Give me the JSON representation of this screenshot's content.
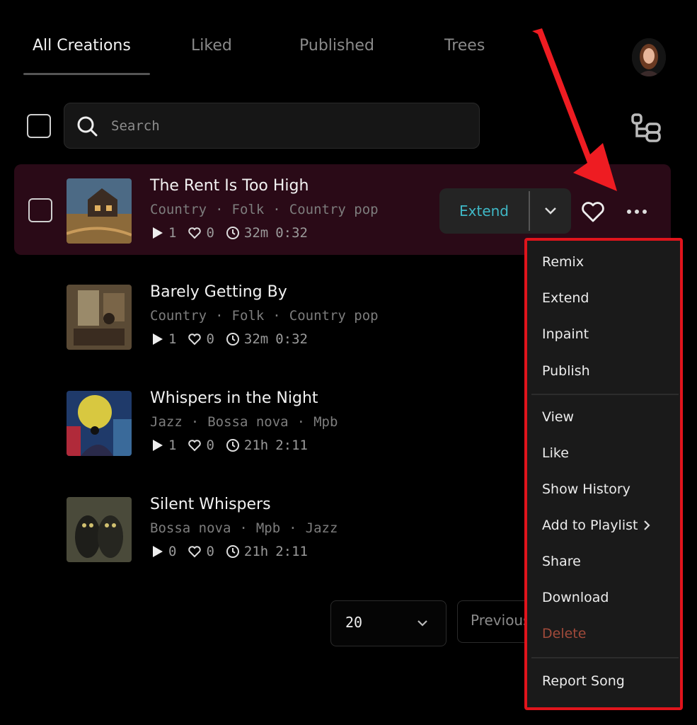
{
  "tabs": [
    {
      "label": "All Creations"
    },
    {
      "label": "Liked"
    },
    {
      "label": "Published"
    },
    {
      "label": "Trees"
    }
  ],
  "search": {
    "placeholder": "Search"
  },
  "songs": [
    {
      "title": "The Rent Is Too High",
      "tags": [
        "Country",
        "Folk",
        "Country pop"
      ],
      "plays": "1",
      "likes": "0",
      "age": "32m",
      "duration": "0:32"
    },
    {
      "title": "Barely Getting By",
      "tags": [
        "Country",
        "Folk",
        "Country pop"
      ],
      "plays": "1",
      "likes": "0",
      "age": "32m",
      "duration": "0:32"
    },
    {
      "title": "Whispers in the Night",
      "tags": [
        "Jazz",
        "Bossa nova",
        "Mpb"
      ],
      "plays": "1",
      "likes": "0",
      "age": "21h",
      "duration": "2:11"
    },
    {
      "title": "Silent Whispers",
      "tags": [
        "Bossa nova",
        "Mpb",
        "Jazz"
      ],
      "plays": "0",
      "likes": "0",
      "age": "21h",
      "duration": "2:11"
    }
  ],
  "actions": {
    "extend_label": "Extend"
  },
  "pagination": {
    "page_size": "20",
    "prev_label": "Previous"
  },
  "menu": {
    "items": [
      {
        "label": "Remix"
      },
      {
        "label": "Extend"
      },
      {
        "label": "Inpaint"
      },
      {
        "label": "Publish"
      },
      {
        "label": "View"
      },
      {
        "label": "Like"
      },
      {
        "label": "Show History"
      },
      {
        "label": "Add to Playlist"
      },
      {
        "label": "Share"
      },
      {
        "label": "Download"
      },
      {
        "label": "Delete"
      },
      {
        "label": "Report Song"
      }
    ]
  },
  "colors": {
    "accent": "#3fb8c6",
    "selected_row": "#2a0a17",
    "highlight": "#e0141c",
    "danger": "#a14a3a"
  },
  "icons": [
    "search-icon",
    "tree-icon",
    "play-icon",
    "heart-icon",
    "clock-icon",
    "chevron-down-icon",
    "more-icon",
    "chevron-right-icon"
  ]
}
